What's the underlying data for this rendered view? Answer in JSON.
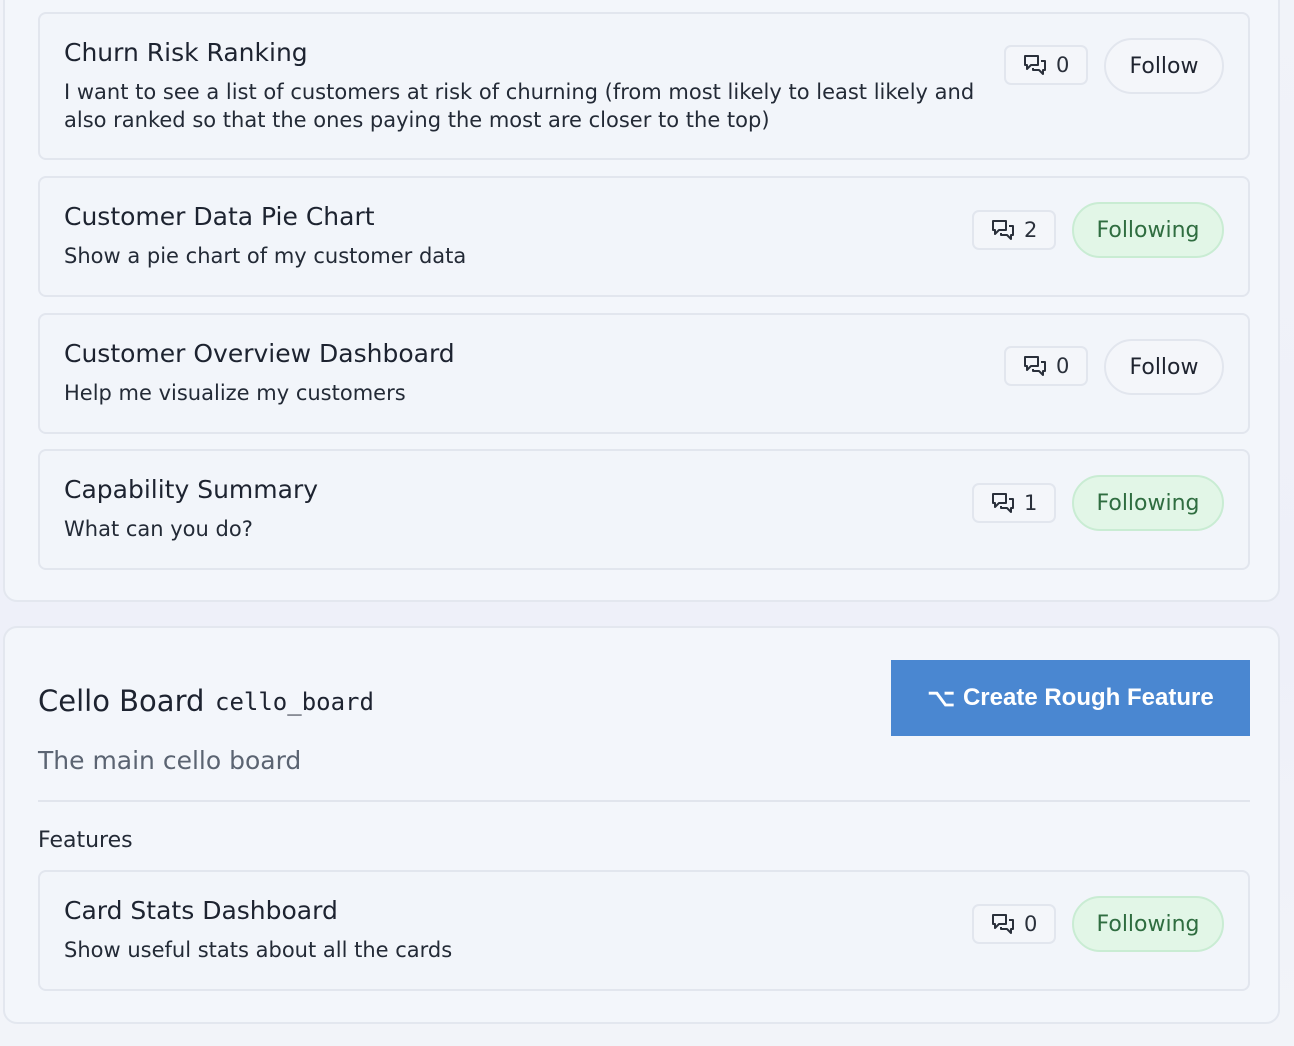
{
  "top_board": {
    "features": [
      {
        "title": "Churn Risk Ranking",
        "description": "I want to see a list of customers at risk of churning (from most likely to least likely and also ranked so that the ones paying the most are closer to the top)",
        "comments": "0",
        "follow_label": "Follow",
        "following": false
      },
      {
        "title": "Customer Data Pie Chart",
        "description": "Show a pie chart of my customer data",
        "comments": "2",
        "follow_label": "Following",
        "following": true
      },
      {
        "title": "Customer Overview Dashboard",
        "description": "Help me visualize my customers",
        "comments": "0",
        "follow_label": "Follow",
        "following": false
      },
      {
        "title": "Capability Summary",
        "description": "What can you do?",
        "comments": "1",
        "follow_label": "Following",
        "following": true
      }
    ]
  },
  "cello_board": {
    "name": "Cello Board",
    "slug": "cello_board",
    "description": "The main cello board",
    "create_button_icon": "⌥",
    "create_button_label": "Create Rough Feature",
    "features_heading": "Features",
    "features": [
      {
        "title": "Card Stats Dashboard",
        "description": "Show useful stats about all the cards",
        "comments": "0",
        "follow_label": "Following",
        "following": true
      }
    ]
  },
  "icons": {
    "comment": "comment-bubbles-icon",
    "create": "option-key-icon"
  },
  "colors": {
    "accent_blue": "#4a87d1",
    "following_bg": "#e2f6e7",
    "following_text": "#2f6d40"
  }
}
